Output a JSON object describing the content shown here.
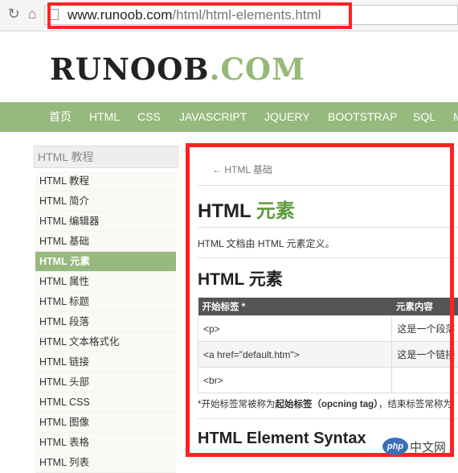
{
  "browser": {
    "url_host": "www.runoob.com",
    "url_path": "/html/html-elements.html"
  },
  "logo": {
    "main": "RUNOOB",
    "suffix": ".COM"
  },
  "nav": [
    "首页",
    "HTML",
    "CSS",
    "JAVASCRIPT",
    "JQUERY",
    "BOOTSTRAP",
    "SQL",
    "M"
  ],
  "sidebar": {
    "title": "HTML 教程",
    "items": [
      "HTML 教程",
      "HTML 简介",
      "HTML 编辑器",
      "HTML 基础",
      "HTML 元素",
      "HTML 属性",
      "HTML 标题",
      "HTML 段落",
      "HTML 文本格式化",
      "HTML 链接",
      "HTML 头部",
      "HTML CSS",
      "HTML 图像",
      "HTML 表格",
      "HTML 列表"
    ],
    "active_index": 4
  },
  "content": {
    "prev_link": "← HTML 基础",
    "h1_prefix": "HTML ",
    "h1_highlight": "元素",
    "intro": "HTML 文档由 HTML 元素定义。",
    "h2": "HTML 元素",
    "table": {
      "headers": [
        "开始标签 *",
        "元素内容"
      ],
      "rows": [
        [
          "<p>",
          "这是一个段落"
        ],
        [
          "<a href=\"default.htm\">",
          "这是一个链接"
        ],
        [
          "<br>",
          ""
        ]
      ]
    },
    "note_prefix": "*开始标签常被称为",
    "note_bold": "起始标签（opcning tag）",
    "note_suffix": "，结束标签常称为",
    "h2b": "HTML Element Syntax"
  },
  "watermark": {
    "logo": "php",
    "text": "中文网"
  },
  "colors": {
    "brand_green": "#96b97d",
    "heading_green": "#5f9a3c",
    "highlight_red": "#ff2222"
  }
}
